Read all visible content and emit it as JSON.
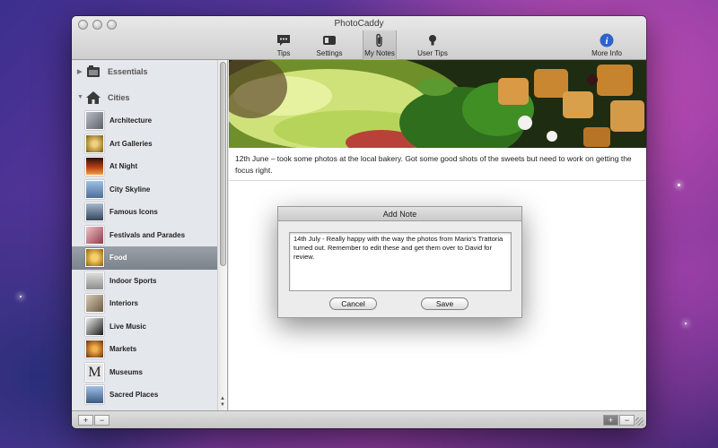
{
  "window": {
    "title": "PhotoCaddy"
  },
  "toolbar": {
    "items": [
      {
        "label": "Tips",
        "icon": "speech-bubble-icon"
      },
      {
        "label": "Settings",
        "icon": "settings-toggle-icon"
      },
      {
        "label": "My Notes",
        "icon": "paperclip-icon",
        "active": true
      },
      {
        "label": "User Tips",
        "icon": "lightbulb-icon"
      },
      {
        "label": "More Info",
        "icon": "info-icon"
      }
    ]
  },
  "sidebar": {
    "groups": [
      {
        "label": "Essentials",
        "icon": "camera-gear-icon",
        "expanded": false
      },
      {
        "label": "Cities",
        "icon": "house-icon",
        "expanded": true
      }
    ],
    "items": [
      {
        "label": "Architecture",
        "color": "#8a8f96"
      },
      {
        "label": "Art Galleries",
        "color": "#c9a24a"
      },
      {
        "label": "At Night",
        "color": "#b0411e"
      },
      {
        "label": "City Skyline",
        "color": "#6d8fb8"
      },
      {
        "label": "Famous Icons",
        "color": "#5b6f8a"
      },
      {
        "label": "Festivals and Parades",
        "color": "#c06b7a"
      },
      {
        "label": "Food",
        "color": "#d4a02a",
        "selected": true
      },
      {
        "label": "Indoor Sports",
        "color": "#a9a9a9"
      },
      {
        "label": "Interiors",
        "color": "#8c7b66"
      },
      {
        "label": "Live Music",
        "color": "#3d3d3d"
      },
      {
        "label": "Markets",
        "color": "#d08a2c"
      },
      {
        "label": "Museums",
        "color": "#d9d9d9"
      },
      {
        "label": "Sacred Places",
        "color": "#6c8eb2"
      }
    ]
  },
  "content": {
    "note": "12th June – took some photos at the local bakery. Got some good shots of the sweets but need to work on getting the focus right."
  },
  "dialog": {
    "title": "Add Note",
    "text": "14th July - Really happy with the way the photos from Mario's Trattoria turned out. Remember to edit these and get them over to David for review.",
    "cancel_label": "Cancel",
    "save_label": "Save"
  },
  "statusbar": {
    "add_label": "+",
    "remove_label": "−"
  }
}
